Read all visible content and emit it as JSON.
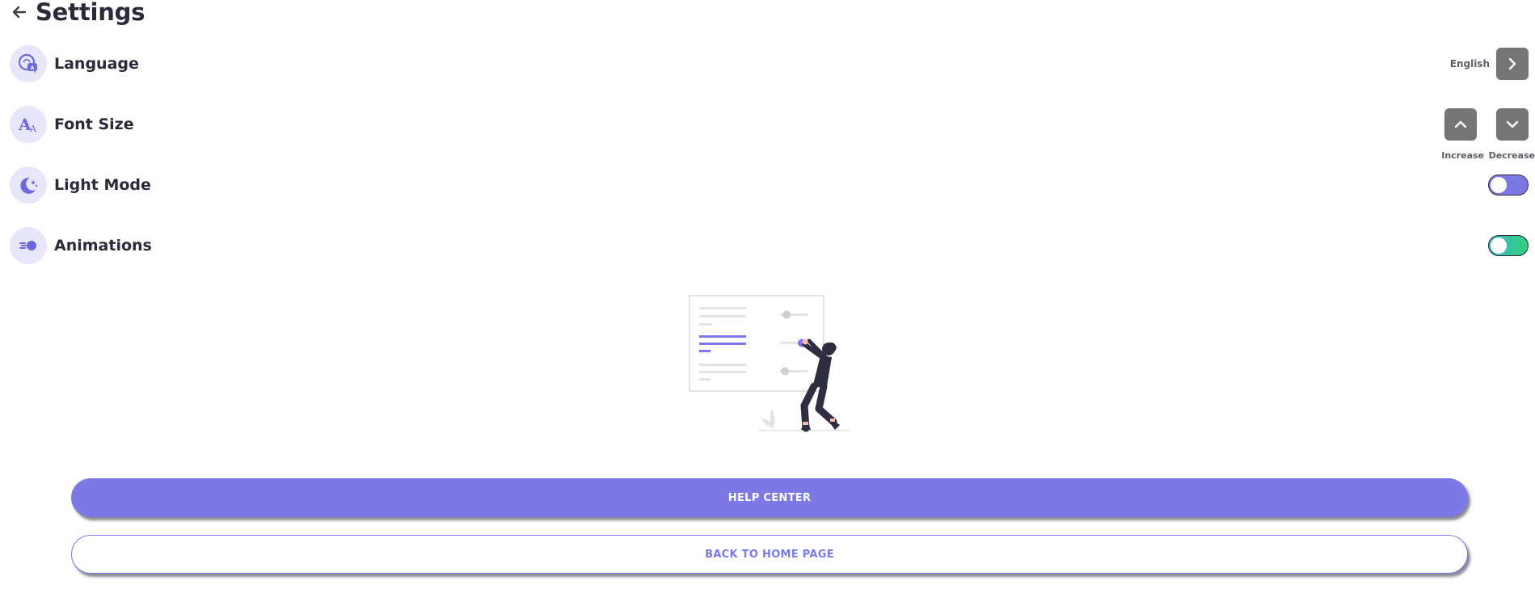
{
  "header": {
    "title": "Settings",
    "back_icon": "arrow-left-icon"
  },
  "settings": {
    "language": {
      "label": "Language",
      "icon": "language-chat-icon",
      "value": "English",
      "action_icon": "chevron-right-icon"
    },
    "font_size": {
      "label": "Font Size",
      "icon": "font-size-icon",
      "increase_label": "Increase",
      "decrease_label": "Decrease",
      "increase_icon": "chevron-up-icon",
      "decrease_icon": "chevron-down-icon"
    },
    "light_mode": {
      "label": "Light Mode",
      "icon": "moon-stars-icon",
      "enabled": false,
      "toggle_color": "#7c78e6"
    },
    "animations": {
      "label": "Animations",
      "icon": "speed-dot-icon",
      "enabled": false,
      "toggle_gradient": [
        "#3bb8c4",
        "#33d07c"
      ]
    }
  },
  "illustration": {
    "icon": "settings-adjusting-person-illustration"
  },
  "buttons": {
    "help_center": "HELP CENTER",
    "back_home": "BACK TO HOME PAGE"
  },
  "colors": {
    "accent": "#7c78e6",
    "icon_bg": "#e8e6fb",
    "control_gray": "#757575",
    "text_dark": "#2b2a3a"
  }
}
